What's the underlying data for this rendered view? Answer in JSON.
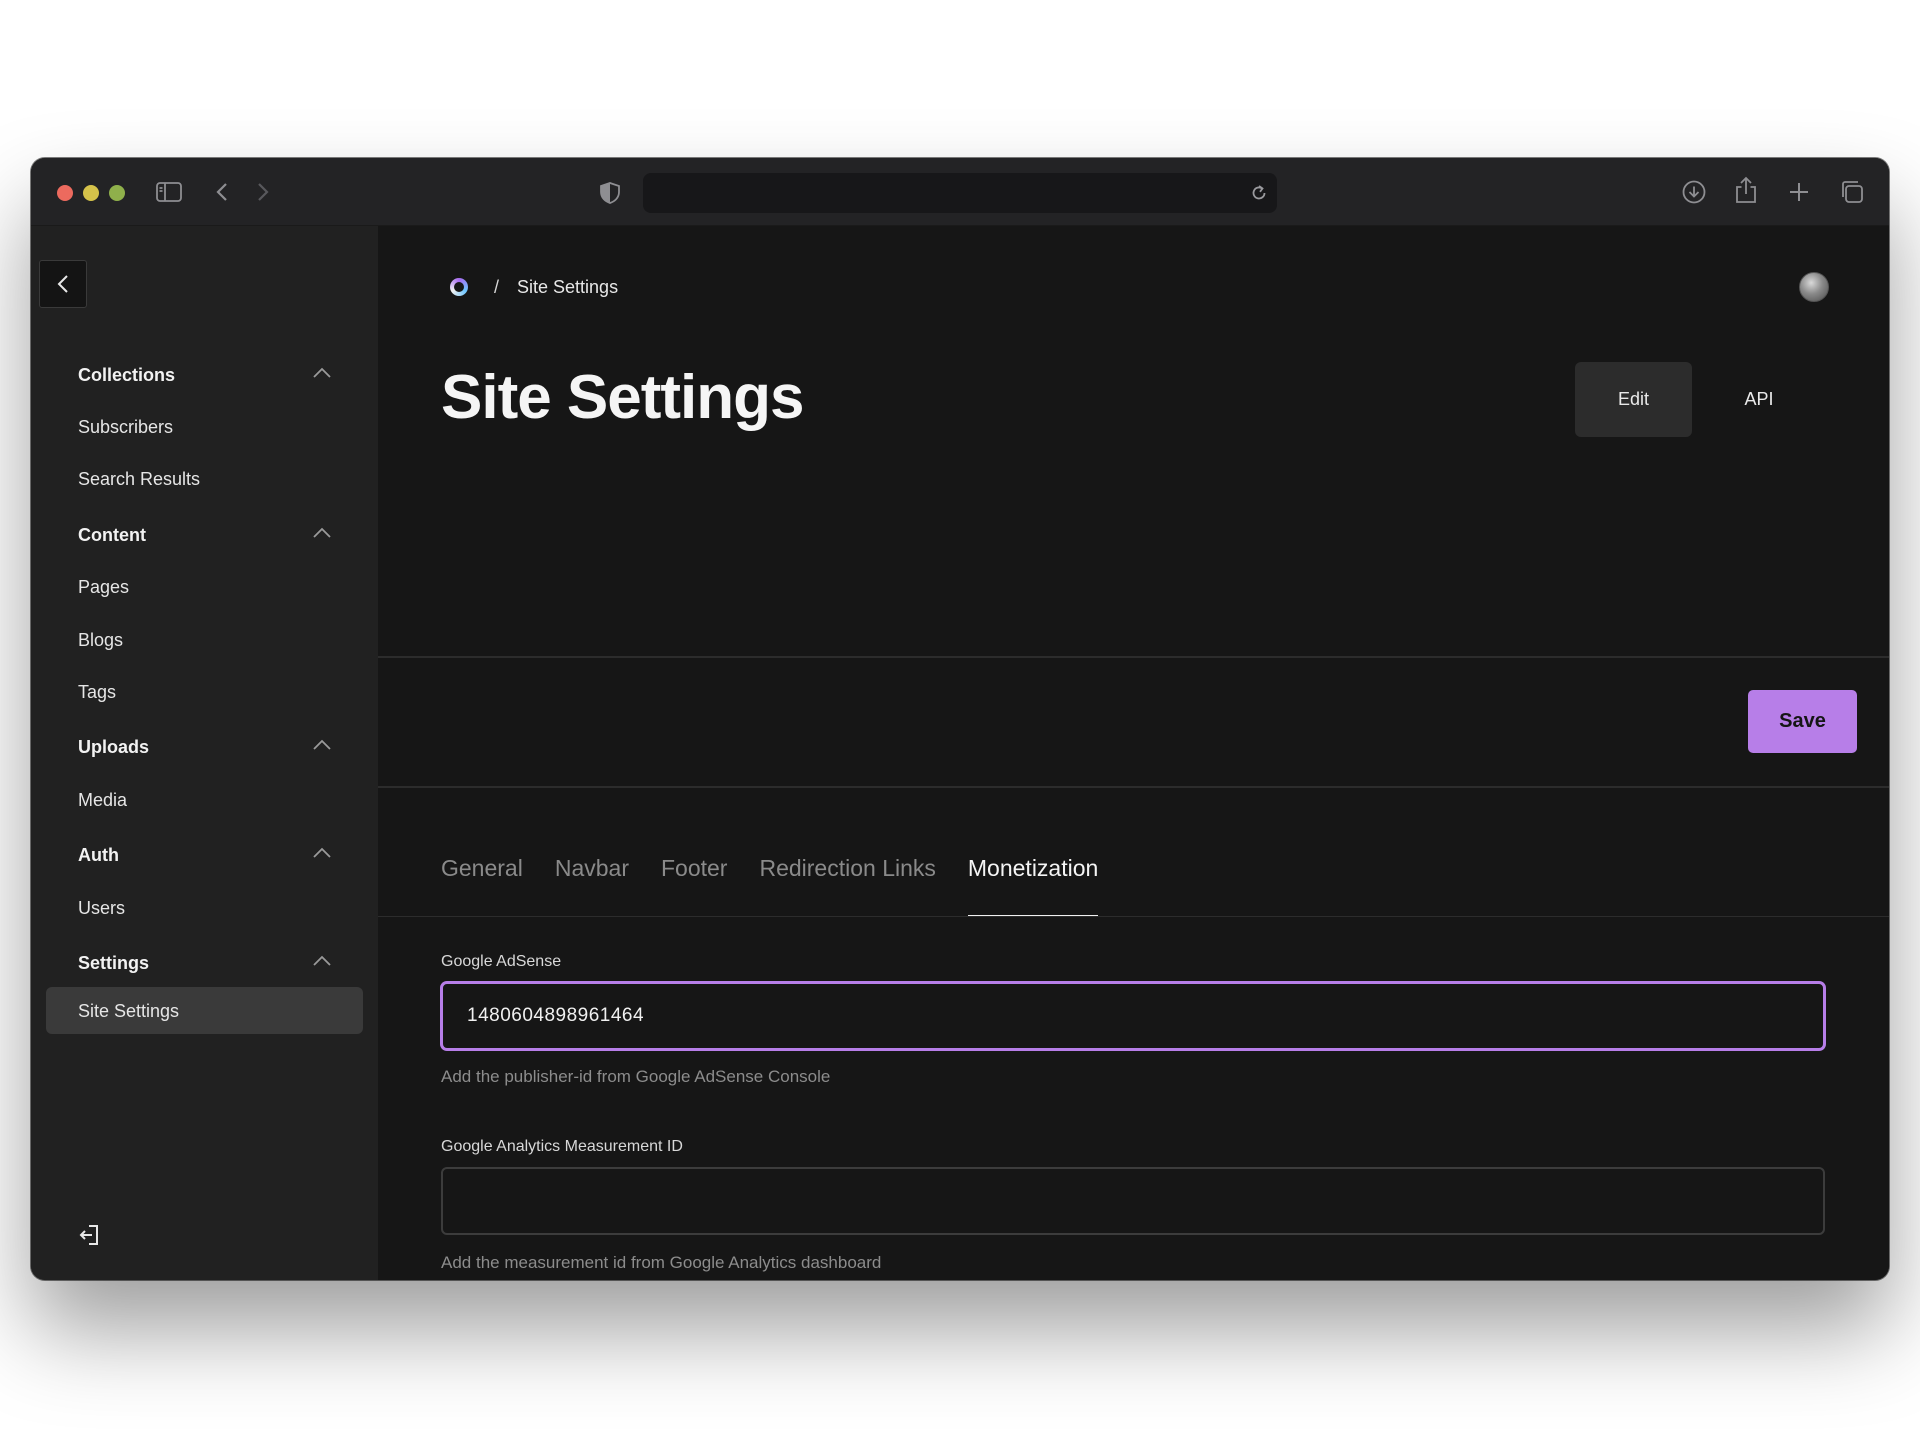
{
  "browser": {
    "url": "",
    "icons": [
      "sidebar-toggle-icon",
      "back-icon",
      "forward-icon",
      "shield-icon",
      "reload-icon",
      "download-icon",
      "share-icon",
      "plus-icon",
      "tabs-icon"
    ]
  },
  "sidebar": {
    "groups": [
      {
        "title": "Collections",
        "items": [
          "Subscribers",
          "Search Results"
        ]
      },
      {
        "title": "Content",
        "items": [
          "Pages",
          "Blogs",
          "Tags"
        ]
      },
      {
        "title": "Uploads",
        "items": [
          "Media"
        ]
      },
      {
        "title": "Auth",
        "items": [
          "Users"
        ]
      },
      {
        "title": "Settings",
        "items": [
          "Site Settings"
        ]
      }
    ],
    "active_item": "Site Settings"
  },
  "breadcrumb": {
    "separator": "/",
    "current": "Site Settings"
  },
  "header": {
    "title": "Site Settings",
    "edit_label": "Edit",
    "api_label": "API"
  },
  "toolbar": {
    "save_label": "Save"
  },
  "tabs": [
    {
      "label": "General",
      "active": false
    },
    {
      "label": "Navbar",
      "active": false
    },
    {
      "label": "Footer",
      "active": false
    },
    {
      "label": "Redirection Links",
      "active": false
    },
    {
      "label": "Monetization",
      "active": true
    }
  ],
  "fields": {
    "adsense": {
      "label": "Google AdSense",
      "value": "1480604898961464",
      "hint": "Add the publisher-id from Google AdSense Console"
    },
    "analytics": {
      "label": "Google Analytics Measurement ID",
      "value": "",
      "hint": "Add the measurement id from Google Analytics dashboard"
    }
  },
  "colors": {
    "accent": "#b77ee8",
    "background": "#161616",
    "sidebar": "#212121"
  }
}
